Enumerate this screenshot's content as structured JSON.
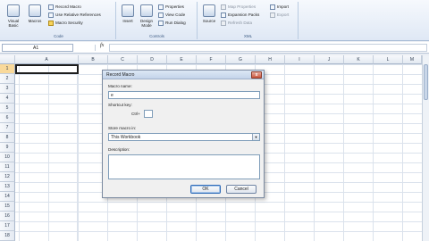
{
  "ribbon": {
    "code_group": {
      "title": "Code",
      "visual_basic": "Visual Basic",
      "macros": "Macros",
      "record_macro": "Record Macro",
      "use_relative_references": "Use Relative References",
      "macro_security": "Macro Security"
    },
    "controls_group": {
      "title": "Controls",
      "insert": "Insert",
      "design_mode": "Design Mode",
      "properties": "Properties",
      "view_code": "View Code",
      "run_dialog": "Run Dialog"
    },
    "xml_group": {
      "title": "XML",
      "source": "Source",
      "map_properties": "Map Properties",
      "expansion_packs": "Expansion Packs",
      "refresh_data": "Refresh Data",
      "import": "Import",
      "export": "Export"
    }
  },
  "formula_bar": {
    "name_box": "A1",
    "fx": "fx",
    "value": ""
  },
  "grid": {
    "columns": [
      "A",
      "B",
      "C",
      "D",
      "E",
      "F",
      "G",
      "H",
      "I",
      "J",
      "K",
      "L",
      "M"
    ],
    "rows": [
      "1",
      "2",
      "3",
      "4",
      "5",
      "6",
      "7",
      "8",
      "9",
      "10",
      "11",
      "12",
      "13",
      "14",
      "15",
      "16",
      "17",
      "18"
    ],
    "selected_cell": "A1"
  },
  "dialog": {
    "title": "Record Macro",
    "close_symbol": "x",
    "macro_name_label": "Macro name:",
    "macro_name_value": "e",
    "shortcut_key_label": "Shortcut key:",
    "ctrl_label": "Ctrl+",
    "shortcut_value": "",
    "store_macro_label": "Store macro in:",
    "store_macro_value": "This Workbook",
    "description_label": "Description:",
    "description_value": "",
    "ok_label": "OK",
    "cancel_label": "Cancel"
  }
}
